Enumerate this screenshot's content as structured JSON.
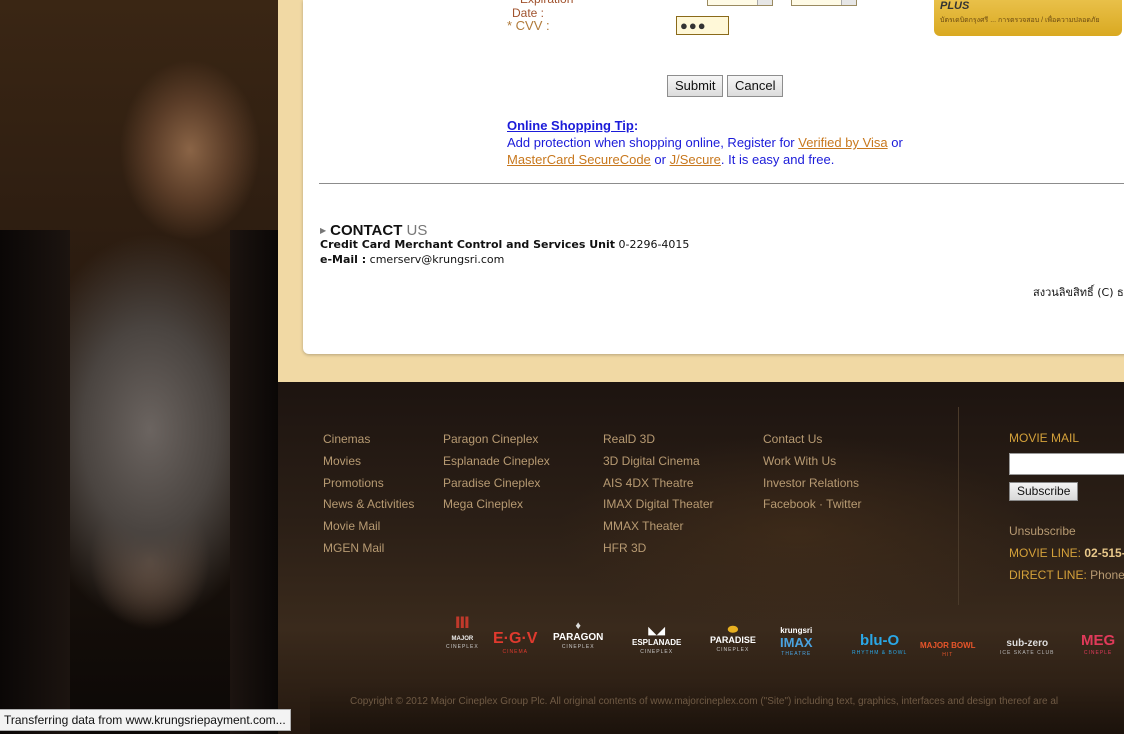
{
  "form": {
    "expiry_label": "* Expiration Date :",
    "cvv_label": "* CVV :",
    "cvv_value": "●●●",
    "submit_label": "Submit",
    "cancel_label": "Cancel"
  },
  "plus_card": {
    "logo": "PLUS",
    "text": "บัตรเดบิตกรุงศรี ... การตรวจสอบ / เพื่อความปลอดภัย"
  },
  "tip": {
    "title": "Online Shopping Tip",
    "colon": ":",
    "line1_prefix": "Add protection when shopping online, Register for ",
    "verified_visa": "Verified by Visa",
    "line1_suffix": " or",
    "mastercard": "MasterCard SecureCode",
    "or": " or ",
    "jsecure": "J/Secure",
    "line2_suffix": ". It is easy and free."
  },
  "contact": {
    "title_bold": "CONTACT",
    "title_light": " US",
    "unit_label": "Credit Card Merchant Control and Services Unit",
    "unit_phone": "0-2296-4015",
    "email_label": "e-Mail :",
    "email": "cmerserv@krungsri.com",
    "copyright": "สงวนลิขสิทธิ์ (C) ธ"
  },
  "footer": {
    "col1": [
      "Cinemas",
      "Movies",
      "Promotions",
      "News & Activities",
      "Movie Mail",
      "MGEN Mail"
    ],
    "col2": [
      "Paragon Cineplex",
      "Esplanade Cineplex",
      "Paradise Cineplex",
      "Mega Cineplex"
    ],
    "col3": [
      "RealD 3D",
      "3D Digital Cinema",
      "AIS 4DX Theatre",
      "IMAX Digital Theater",
      "MMAX Theater",
      "HFR 3D"
    ],
    "col4": [
      "Contact Us",
      "Work With Us",
      "Investor Relations"
    ],
    "facebook": "Facebook",
    "dot": " · ",
    "twitter": "Twitter",
    "movie_mail_title": "MOVIE MAIL",
    "subscribe": "Subscribe",
    "unsubscribe": "Unsubscribe",
    "movie_line_label": "MOVIE LINE: ",
    "movie_line_value": "02-515-",
    "direct_line_label": "DIRECT LINE: ",
    "direct_line_value": "Phone",
    "copyright": "Copyright © 2012 Major Cineplex Group Plc. All original contents of www.majorcineplex.com (\"Site\") including text, graphics, interfaces and design thereof are al"
  },
  "logos": [
    {
      "name": "MAJOR",
      "sub": "CINEPLEX",
      "color": "#c0392b"
    },
    {
      "name": "E·G·V",
      "sub": "CINEMA",
      "color": "#e03a2e"
    },
    {
      "name": "PARAGON",
      "sub": "CINEPLEX",
      "color": "#ffffff"
    },
    {
      "name": "ESPLANADE",
      "sub": "CINEPLEX",
      "color": "#ffffff"
    },
    {
      "name": "PARADISE",
      "sub": "CINEPLEX",
      "color": "#ffffff"
    },
    {
      "name": "IMAX",
      "sub": "THEATRE",
      "top": "krungsri",
      "color": "#4aa3e0"
    },
    {
      "name": "blu-O",
      "sub": "RHYTHM & BOWL",
      "color": "#2aa7e6"
    },
    {
      "name": "MAJOR BOWL",
      "sub": "HIT",
      "color": "#e8552a"
    },
    {
      "name": "sub-zero",
      "sub": "ICE SKATE CLUB",
      "color": "#dddddd"
    },
    {
      "name": "MEG",
      "sub": "CINEPLE",
      "color": "#e03a5a"
    }
  ],
  "status": "Transferring data from www.krungsriepayment.com..."
}
